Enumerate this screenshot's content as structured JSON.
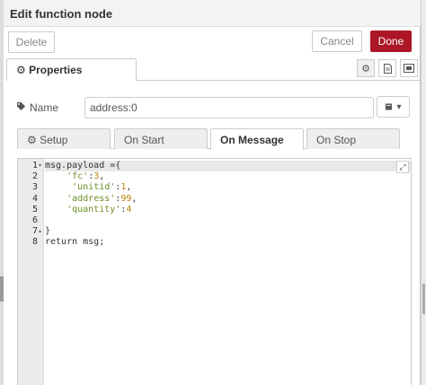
{
  "tray": {
    "title": "Edit function node"
  },
  "buttons": {
    "delete": "Delete",
    "cancel": "Cancel",
    "done": "Done"
  },
  "tabs": {
    "properties": "Properties"
  },
  "icons": {
    "properties": "gear-icon",
    "description": "document-icon",
    "appearance": "layout-icon",
    "name": "tag-icon",
    "icon_select": "book-icon",
    "expand": "expand-icon"
  },
  "form": {
    "name_label": "Name",
    "name_value": "address:0",
    "icon_select_caret": "▾"
  },
  "subtabs": [
    "Setup",
    "On Start",
    "On Message",
    "On Stop"
  ],
  "active_subtab": "On Message",
  "editor": {
    "active_line": 1,
    "lines": [
      {
        "n": "1",
        "fold": "▾",
        "text": "msg.payload ={"
      },
      {
        "n": "2",
        "fold": "",
        "text": "    'fc':3,"
      },
      {
        "n": "3",
        "fold": "",
        "text": "     'unitid':1,"
      },
      {
        "n": "4",
        "fold": "",
        "text": "    'address':99,"
      },
      {
        "n": "5",
        "fold": "",
        "text": "    'quantity':4"
      },
      {
        "n": "6",
        "fold": "",
        "text": ""
      },
      {
        "n": "7",
        "fold": "▴",
        "text": "}"
      },
      {
        "n": "8",
        "fold": "",
        "text": "return msg;"
      }
    ]
  },
  "colors": {
    "accent": "#ad1625",
    "code_string": "#6b8e23",
    "code_number": "#b8860b"
  }
}
